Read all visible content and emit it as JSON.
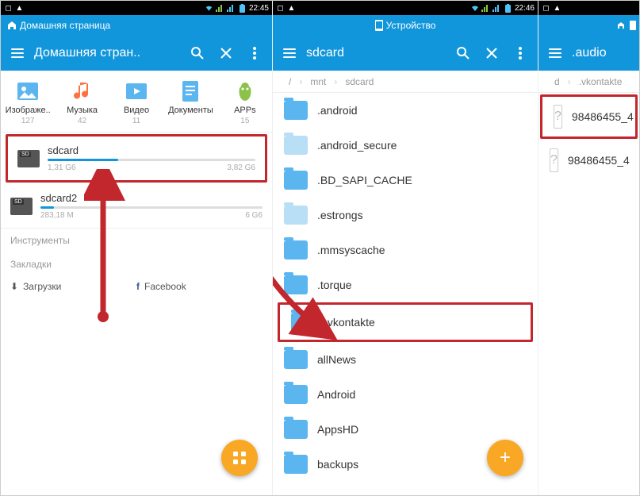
{
  "panel1": {
    "status_time": "22:45",
    "tab_title": "Домашняя страница",
    "header_title": "Домашняя стран..",
    "categories": [
      {
        "label": "Изображе..",
        "count": "127"
      },
      {
        "label": "Музыка",
        "count": "42"
      },
      {
        "label": "Видео",
        "count": "11"
      },
      {
        "label": "Документы",
        "count": ""
      },
      {
        "label": "APPs",
        "count": "15"
      }
    ],
    "storages": [
      {
        "name": "sdcard",
        "used": "1,31 G6",
        "total": "3,82 G6",
        "fill": 34
      },
      {
        "name": "sdcard2",
        "used": "283,18 M",
        "total": "6 G6",
        "fill": 6
      }
    ],
    "section_tools": "Инструменты",
    "section_bookmarks": "Закладки",
    "bm1": "Загрузки",
    "bm2": "Facebook"
  },
  "panel2": {
    "status_time": "22:46",
    "tab_title": "Устройство",
    "header_title": "sdcard",
    "breadcrumb": [
      "/",
      "mnt",
      "sdcard"
    ],
    "folders": [
      {
        "name": ".android",
        "dim": false
      },
      {
        "name": ".android_secure",
        "dim": true
      },
      {
        "name": ".BD_SAPI_CACHE",
        "dim": false
      },
      {
        "name": ".estrongs",
        "dim": true
      },
      {
        "name": ".mmsyscache",
        "dim": false
      },
      {
        "name": ".torque",
        "dim": false
      },
      {
        "name": ".vkontakte",
        "dim": false,
        "highlight": true
      },
      {
        "name": "allNews",
        "dim": false
      },
      {
        "name": "Android",
        "dim": false
      },
      {
        "name": "AppsHD",
        "dim": false
      },
      {
        "name": "backups",
        "dim": false
      }
    ]
  },
  "panel3": {
    "header_title": ".audio",
    "breadcrumb": [
      "d",
      ".vkontakte"
    ],
    "files": [
      {
        "name": "98486455_4",
        "highlight": true
      },
      {
        "name": "98486455_4",
        "highlight": false
      }
    ]
  }
}
